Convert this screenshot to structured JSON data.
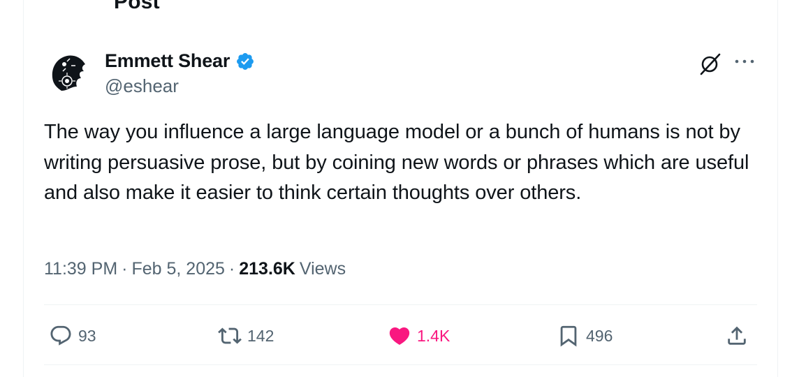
{
  "header": {
    "title": "Post",
    "back_icon": "arrow-left-icon"
  },
  "post": {
    "author": {
      "display_name": "Emmett Shear",
      "handle": "@eshear",
      "verified": true,
      "verified_color": "#1d9bf0"
    },
    "text": "The way you influence a large language model or a bunch of humans is not by writing persuasive prose, but by coining new words or phrases which are useful and also make it easier to think certain thoughts over others.",
    "time": "11:39 PM",
    "date": "Feb 5, 2025",
    "separator": "·",
    "views_count": "213.6K",
    "views_label": "Views"
  },
  "actions": {
    "replies": "93",
    "reposts": "142",
    "likes": "1.4K",
    "bookmarks": "496",
    "liked": true,
    "like_color": "#f91880"
  },
  "colors": {
    "text_primary": "#0f1419",
    "text_secondary": "#536471",
    "divider": "#eff3f4"
  }
}
